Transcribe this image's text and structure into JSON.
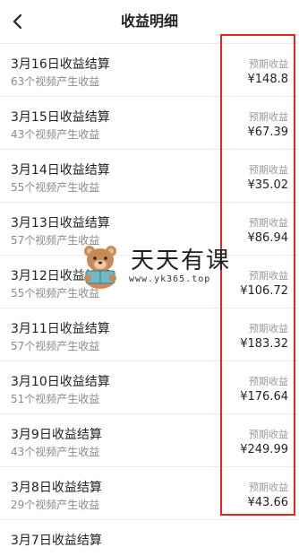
{
  "header": {
    "title": "收益明细",
    "back_icon": "chevron-left-icon"
  },
  "rows": [
    {
      "name": "3月16日收益结算",
      "sub": "63个视频产生收益",
      "earning_label": "预期收益",
      "amount": "¥148.8"
    },
    {
      "name": "3月15日收益结算",
      "sub": "43个视频产生收益",
      "earning_label": "预期收益",
      "amount": "¥67.39"
    },
    {
      "name": "3月14日收益结算",
      "sub": "55个视频产生收益",
      "earning_label": "预期收益",
      "amount": "¥35.02"
    },
    {
      "name": "3月13日收益结算",
      "sub": "57个视频产生收益",
      "earning_label": "预期收益",
      "amount": "¥86.94"
    },
    {
      "name": "3月12日收益结算",
      "sub": "55个视频产生收益",
      "earning_label": "预期收益",
      "amount": "¥106.72"
    },
    {
      "name": "3月11日收益结算",
      "sub": "57个视频产生收益",
      "earning_label": "预期收益",
      "amount": "¥183.32"
    },
    {
      "name": "3月10日收益结算",
      "sub": "51个视频产生收益",
      "earning_label": "预期收益",
      "amount": "¥176.64"
    },
    {
      "name": "3月9日收益结算",
      "sub": "43个视频产生收益",
      "earning_label": "预期收益",
      "amount": "¥249.99"
    },
    {
      "name": "3月8日收益结算",
      "sub": "29个视频产生收益",
      "earning_label": "预期收益",
      "amount": "¥43.66"
    },
    {
      "name": "3月7日收益结算",
      "sub": "",
      "earning_label": "",
      "amount": ""
    }
  ],
  "watermark": {
    "title": "天天有课",
    "url": "www.yk365.top"
  },
  "colors": {
    "highlight": "#e8261c",
    "text_primary": "#222222",
    "text_secondary": "#8a8a8a"
  }
}
